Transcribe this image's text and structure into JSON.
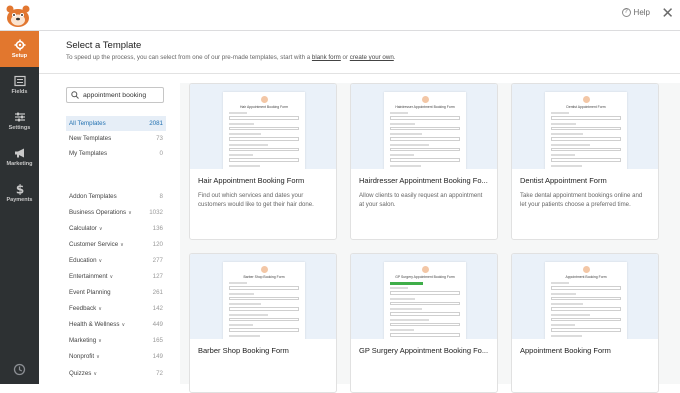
{
  "header": {
    "help_label": "Help",
    "close_glyph": "✕",
    "accent": "#e2772e"
  },
  "nav": {
    "items": [
      {
        "label": "Setup",
        "icon": "gear-icon",
        "active": true
      },
      {
        "label": "Fields",
        "icon": "fields-icon"
      },
      {
        "label": "Settings",
        "icon": "sliders-icon"
      },
      {
        "label": "Marketing",
        "icon": "megaphone-icon"
      },
      {
        "label": "Payments",
        "icon": "dollar-icon"
      }
    ]
  },
  "page": {
    "title": "Select a Template",
    "subtitle_pre": "To speed up the process, you can select from one of our pre-made templates, start with a ",
    "blank_link": "blank form",
    "subtitle_mid": " or ",
    "own_link": "create your own",
    "subtitle_end": "."
  },
  "search": {
    "value": "appointment booking"
  },
  "categories_top": [
    {
      "label": "All Templates",
      "count": "2081"
    },
    {
      "label": "New Templates",
      "count": "73"
    },
    {
      "label": "My Templates",
      "count": "0"
    }
  ],
  "categories": [
    {
      "label": "Addon Templates",
      "count": "8",
      "chev": ""
    },
    {
      "label": "Business Operations",
      "count": "1032",
      "chev": "∨"
    },
    {
      "label": "Calculator",
      "count": "136",
      "chev": "∨"
    },
    {
      "label": "Customer Service",
      "count": "120",
      "chev": "∨"
    },
    {
      "label": "Education",
      "count": "277",
      "chev": "∨"
    },
    {
      "label": "Entertainment",
      "count": "127",
      "chev": "∨"
    },
    {
      "label": "Event Planning",
      "count": "261",
      "chev": ""
    },
    {
      "label": "Feedback",
      "count": "142",
      "chev": "∨"
    },
    {
      "label": "Health & Wellness",
      "count": "449",
      "chev": "∨"
    },
    {
      "label": "Marketing",
      "count": "165",
      "chev": "∨"
    },
    {
      "label": "Nonprofit",
      "count": "149",
      "chev": "∨"
    },
    {
      "label": "Quizzes",
      "count": "72",
      "chev": "∨"
    }
  ],
  "templates": [
    {
      "thumb_title": "Hair Appointment Booking Form",
      "name": "Hair Appointment Booking Form",
      "desc": "Find out which services and dates your customers would like to get their hair done."
    },
    {
      "thumb_title": "Hairdresser Appointment Booking Form",
      "name": "Hairdresser Appointment Booking Fo...",
      "desc": "Allow clients to easily request an appointment at your salon."
    },
    {
      "thumb_title": "Dentist Appointment Form",
      "name": "Dentist Appointment Form",
      "desc": "Take dental appointment bookings online and let your patients choose a preferred time."
    },
    {
      "thumb_title": "Barber Shop Booking Form",
      "name": "Barber Shop Booking Form",
      "desc": ""
    },
    {
      "thumb_title": "GP Surgery Appointment Booking Form",
      "name": "GP Surgery Appointment Booking Fo...",
      "desc": ""
    },
    {
      "thumb_title": "Appointment Booking Form",
      "name": "Appointment Booking Form",
      "desc": ""
    }
  ]
}
